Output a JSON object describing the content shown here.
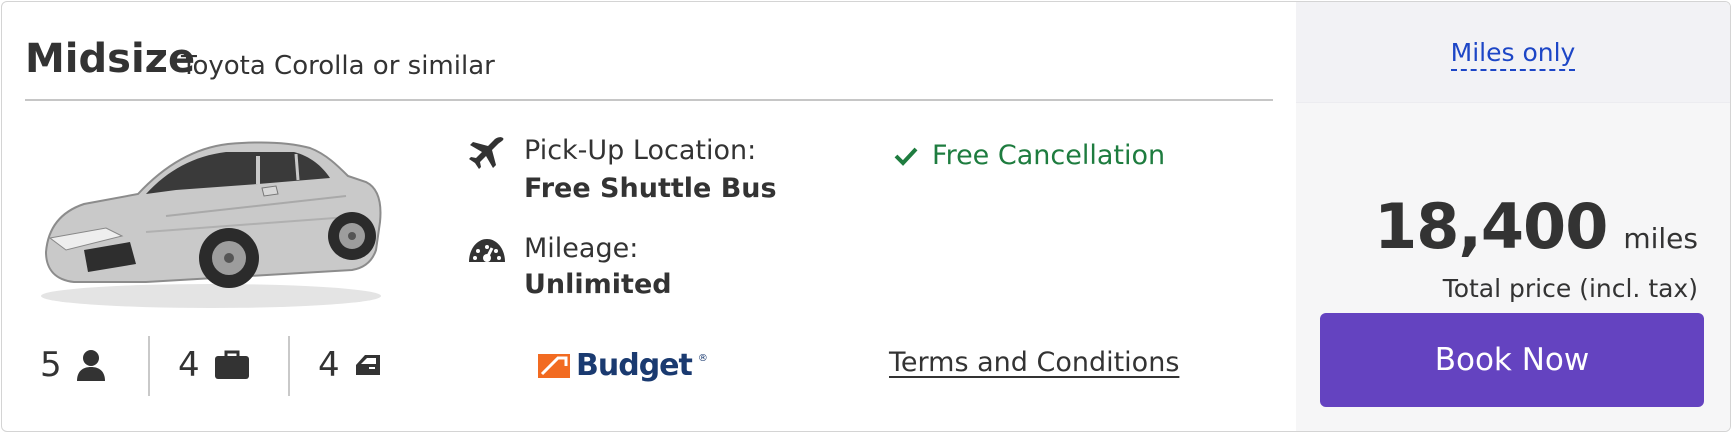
{
  "header": {
    "car_class": "Midsize",
    "car_model": "Toyota Corolla or similar"
  },
  "specs": {
    "passengers": "5",
    "bags": "4",
    "doors": "4"
  },
  "pickup": {
    "label": "Pick-Up Location:",
    "value": "Free Shuttle Bus"
  },
  "mileage": {
    "label": "Mileage:",
    "value": "Unlimited"
  },
  "cancellation": {
    "label": "Free Cancellation"
  },
  "vendor": {
    "name": "Budget",
    "trademark": "®"
  },
  "links": {
    "terms": "Terms and Conditions"
  },
  "pricing": {
    "tab_label": "Miles only",
    "amount": "18,400",
    "unit": "miles",
    "note": "Total price (incl. tax)"
  },
  "actions": {
    "book_label": "Book Now"
  },
  "icons": {
    "pickup": "plane-icon",
    "mileage": "speedometer-icon",
    "cancel": "checkmark-icon",
    "passengers": "person-icon",
    "bags": "briefcase-icon",
    "doors": "car-door-icon"
  },
  "colors": {
    "accent": "#6443c0",
    "success": "#1e7c3f",
    "link": "#1d46c6",
    "brand_orange": "#f26b21",
    "brand_navy": "#1a3a70"
  }
}
